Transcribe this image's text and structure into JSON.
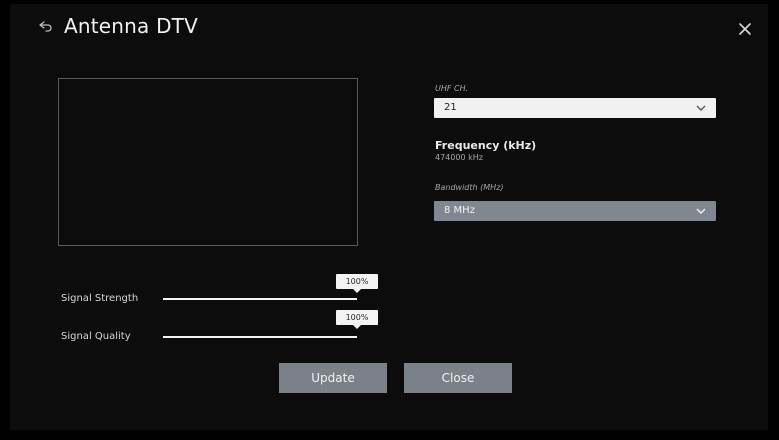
{
  "window": {
    "title": "Antenna DTV"
  },
  "channel": {
    "label": "UHF CH.",
    "value": "21"
  },
  "frequency": {
    "label": "Frequency (kHz)",
    "value": "474000 kHz"
  },
  "bandwidth": {
    "label": "Bandwidth (MHz)",
    "value": "8 MHz"
  },
  "signal": {
    "strength": {
      "label": "Signal Strength",
      "value_text": "100%",
      "level": 1.0
    },
    "quality": {
      "label": "Signal Quality",
      "value_text": "100%",
      "level": 1.0
    }
  },
  "buttons": {
    "update_label": "Update",
    "close_label": "Close"
  },
  "icons": {
    "back": "back-arrow-icon",
    "close": "close-icon",
    "dropdown": "chevron-down-icon"
  },
  "colors": {
    "background": "#0c0c0d",
    "button": "#7b8189",
    "selected_dropdown": "#808790",
    "dropdown": "#f1f1f1"
  }
}
